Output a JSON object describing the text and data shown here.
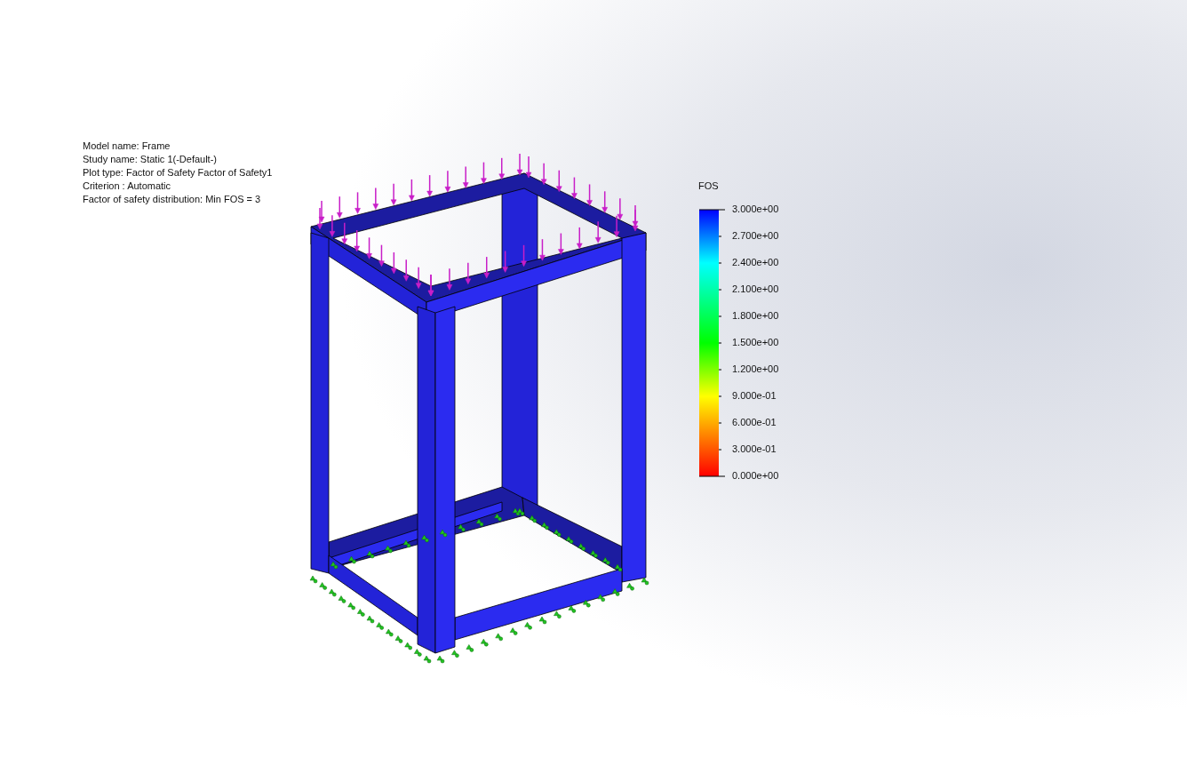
{
  "plot_info": [
    "Model name: Frame",
    "Study name: Static 1(-Default-)",
    "Plot type: Factor of Safety Factor of Safety1",
    "Criterion : Automatic",
    "Factor of safety distribution: Min FOS = 3"
  ],
  "legend": {
    "title": "FOS",
    "labels": [
      "3.000e+00",
      "2.700e+00",
      "2.400e+00",
      "2.100e+00",
      "1.800e+00",
      "1.500e+00",
      "1.200e+00",
      "9.000e-01",
      "6.000e-01",
      "3.000e-01",
      "0.000e+00"
    ]
  },
  "model": {
    "kind": "frame"
  }
}
